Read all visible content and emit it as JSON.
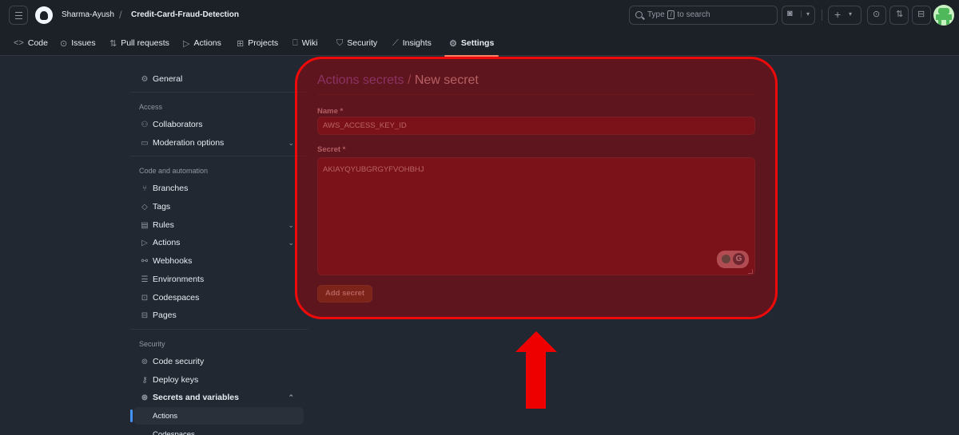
{
  "header": {
    "owner": "Sharma-Ayush",
    "separator": "/",
    "repo": "Credit-Card-Fraud-Detection",
    "search": {
      "prefix": "Type",
      "key": "/",
      "suffix": "to search"
    }
  },
  "tabs": [
    {
      "label": "Code",
      "icon": "code-icon"
    },
    {
      "label": "Issues",
      "icon": "issue-icon"
    },
    {
      "label": "Pull requests",
      "icon": "pull-request-icon"
    },
    {
      "label": "Actions",
      "icon": "play-icon"
    },
    {
      "label": "Projects",
      "icon": "table-icon"
    },
    {
      "label": "Wiki",
      "icon": "book-icon"
    },
    {
      "label": "Security",
      "icon": "shield-icon"
    },
    {
      "label": "Insights",
      "icon": "graph-icon"
    },
    {
      "label": "Settings",
      "icon": "gear-icon",
      "active": true
    }
  ],
  "sidebar": {
    "general": "General",
    "sections": {
      "access": "Access",
      "code_automation": "Code and automation",
      "security": "Security"
    },
    "items": {
      "collaborators": "Collaborators",
      "moderation": "Moderation options",
      "branches": "Branches",
      "tags": "Tags",
      "rules": "Rules",
      "actions": "Actions",
      "webhooks": "Webhooks",
      "environments": "Environments",
      "codespaces": "Codespaces",
      "pages": "Pages",
      "code_security": "Code security",
      "deploy_keys": "Deploy keys",
      "secrets_variables": "Secrets and variables",
      "sub_actions": "Actions",
      "sub_codespaces": "Codespaces"
    }
  },
  "form": {
    "breadcrumb_link": "Actions secrets",
    "breadcrumb_sep": "/",
    "title": "New secret",
    "name_label": "Name *",
    "name_value": "AWS_ACCESS_KEY_ID",
    "secret_label": "Secret *",
    "secret_value": "AKIAYQYUBGRGYFVOHBHJ",
    "submit": "Add secret",
    "grammarly_letter": "G"
  },
  "colors": {
    "highlight_border": "#ee0a0a",
    "arrow": "#ee0000",
    "link": "#8e6ad9",
    "tab_underline": "#f78166"
  }
}
